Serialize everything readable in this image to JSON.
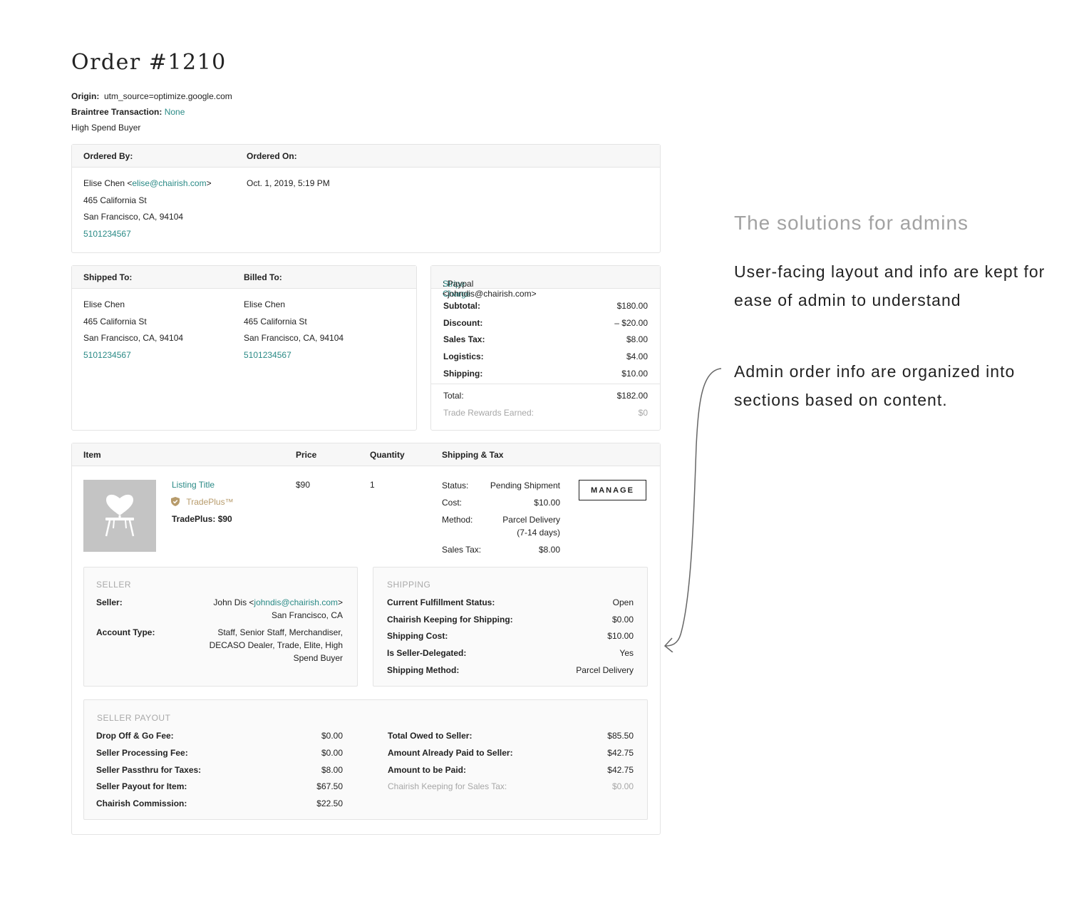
{
  "order": {
    "title": "Order #1210",
    "origin_label": "Origin:",
    "origin_value": "utm_source=optimize.google.com",
    "braintree_label": "Braintree Transaction:",
    "braintree_value": "None",
    "buyer_tag": "High Spend Buyer"
  },
  "ordered": {
    "by_label": "Ordered By:",
    "on_label": "Ordered On:",
    "name": "Elise Chen <",
    "email": "elise@chairish.com",
    "email_close": ">",
    "address1": "465 California St",
    "address2": "San Francisco, CA, 94104",
    "phone": "5101234567",
    "date": "Oct. 1, 2019, 5:19 PM"
  },
  "shipped": {
    "label": "Shipped To:",
    "name": "Elise Chen",
    "address1": "465 California St",
    "address2": "San Francisco, CA, 94104",
    "phone": "5101234567"
  },
  "billed": {
    "label": "Billed To:",
    "name": "Elise Chen",
    "address1": "465 California St",
    "address2": "San Francisco, CA, 94104",
    "phone": "5101234567"
  },
  "charge": {
    "link": "Stripe Charge",
    "method": ": Paypal <johndis@chairish.com>",
    "rows": [
      {
        "label": "Subtotal:",
        "value": "$180.00"
      },
      {
        "label": "Discount:",
        "value": "– $20.00"
      },
      {
        "label": "Sales Tax:",
        "value": "$8.00"
      },
      {
        "label": "Logistics:",
        "value": "$4.00"
      },
      {
        "label": "Shipping:",
        "value": "$10.00"
      }
    ],
    "total_label": "Total:",
    "total_value": "$182.00",
    "rewards_label": "Trade Rewards Earned:",
    "rewards_value": "$0"
  },
  "items": {
    "headers": {
      "item": "Item",
      "price": "Price",
      "quantity": "Quantity",
      "shipping_tax": "Shipping & Tax"
    },
    "listing_title": "Listing Title",
    "tradeplus_badge": "TradePlus™",
    "tradeplus_price": "TradePlus: $90",
    "price": "$90",
    "quantity": "1",
    "status_label": "Status:",
    "status_value": "Pending Shipment",
    "cost_label": "Cost:",
    "cost_value": "$10.00",
    "method_label": "Method:",
    "method_value1": "Parcel Delivery",
    "method_value2": "(7-14 days)",
    "tax_label": "Sales Tax:",
    "tax_value": "$8.00",
    "manage_label": "MANAGE",
    "thumbnail_icon": "chair-heart-icon"
  },
  "seller": {
    "section_title": "SELLER",
    "seller_label": "Seller:",
    "seller_name": "John Dis <",
    "seller_email": "johndis@chairish.com",
    "seller_email_close": ">",
    "seller_location": "San Francisco, CA",
    "account_label": "Account Type:",
    "account_line1": "Staff, Senior Staff, Merchandiser,",
    "account_line2": "DECASO Dealer, Trade, Elite, High",
    "account_line3": "Spend Buyer"
  },
  "shipping": {
    "section_title": "SHIPPING",
    "rows": [
      {
        "label": "Current Fulfillment Status:",
        "value": "Open"
      },
      {
        "label": "Chairish Keeping for Shipping:",
        "value": "$0.00"
      },
      {
        "label": "Shipping Cost:",
        "value": "$10.00"
      },
      {
        "label": "Is Seller-Delegated:",
        "value": "Yes"
      },
      {
        "label": "Shipping Method:",
        "value": "Parcel Delivery"
      }
    ]
  },
  "payout": {
    "section_title": "SELLER PAYOUT",
    "left": [
      {
        "label": "Drop Off & Go Fee:",
        "value": "$0.00"
      },
      {
        "label": "Seller Processing Fee:",
        "value": "$0.00"
      },
      {
        "label": "Seller Passthru for Taxes:",
        "value": "$8.00"
      },
      {
        "label": "Seller Payout for Item:",
        "value": "$67.50"
      },
      {
        "label": "Chairish Commission:",
        "value": "$22.50"
      }
    ],
    "right": [
      {
        "label": "Total Owed to Seller:",
        "value": "$85.50"
      },
      {
        "label": "Amount Already Paid to Seller:",
        "value": "$42.75"
      },
      {
        "label": "Amount to be Paid:",
        "value": "$42.75"
      }
    ],
    "right_muted": {
      "label": "Chairish Keeping for Sales Tax:",
      "value": "$0.00"
    }
  },
  "annotation": {
    "heading": "The solutions for admins",
    "para1": "User-facing layout and info are kept for ease of admin to understand",
    "para2": "Admin order info are organized into sections based on content."
  },
  "colors": {
    "accent": "#2a8a86",
    "tradeplus": "#b79b6b",
    "muted": "#a7a7a7",
    "border": "#e4e4e4"
  }
}
